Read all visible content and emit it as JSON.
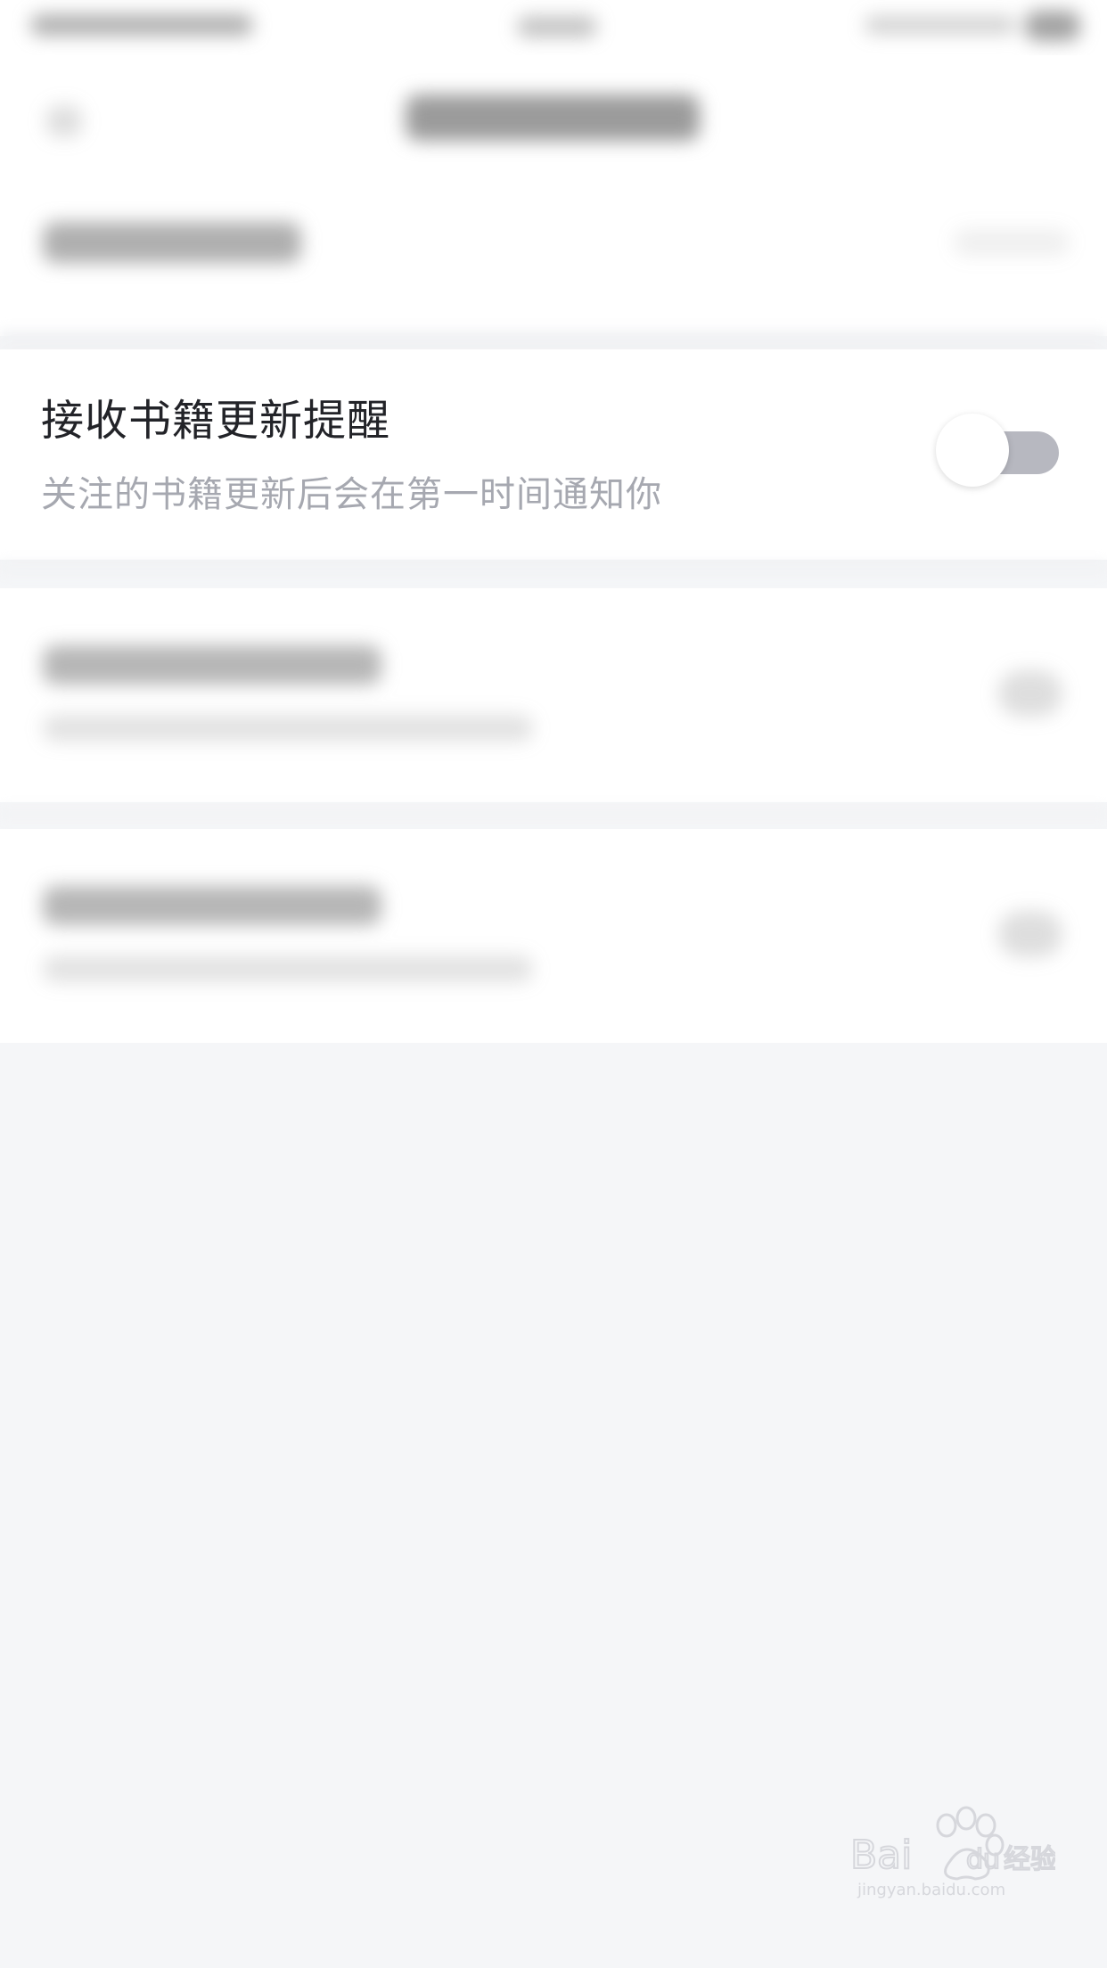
{
  "setting": {
    "title": "接收书籍更新提醒",
    "description": "关注的书籍更新后会在第一时间通知你",
    "enabled": false
  },
  "colors": {
    "background": "#f5f6f8",
    "card": "#ffffff",
    "title": "#222328",
    "subtitle": "#a6a8b0",
    "toggle_track_off": "#b7b8c0",
    "toggle_knob": "#ffffff"
  },
  "icons": {
    "watermark": "baidu-jingyan-logo"
  }
}
